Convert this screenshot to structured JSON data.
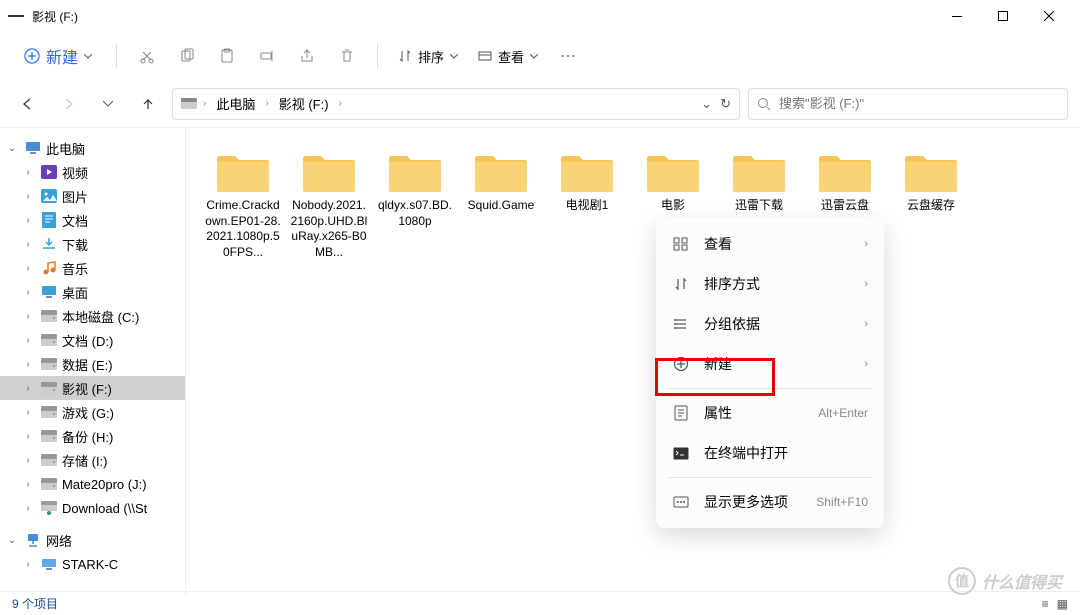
{
  "window": {
    "title": "影视 (F:)"
  },
  "toolbar": {
    "new_label": "新建",
    "sort_label": "排序",
    "view_label": "查看"
  },
  "breadcrumb": {
    "items": [
      "此电脑",
      "影视 (F:)"
    ]
  },
  "search": {
    "placeholder": "搜索\"影视 (F:)\""
  },
  "sidebar": {
    "root_pc": "此电脑",
    "items": [
      {
        "label": "视频",
        "icon": "video",
        "color": "#6a3eb8"
      },
      {
        "label": "图片",
        "icon": "pictures",
        "color": "#3aa0d8"
      },
      {
        "label": "文档",
        "icon": "documents",
        "color": "#3aa0d8"
      },
      {
        "label": "下载",
        "icon": "downloads",
        "color": "#3aa0d8"
      },
      {
        "label": "音乐",
        "icon": "music",
        "color": "#e07c2c"
      },
      {
        "label": "桌面",
        "icon": "desktop",
        "color": "#3aa0d8"
      },
      {
        "label": "本地磁盘 (C:)",
        "icon": "drive",
        "color": "#888"
      },
      {
        "label": "文档 (D:)",
        "icon": "drive",
        "color": "#888"
      },
      {
        "label": "数据 (E:)",
        "icon": "drive",
        "color": "#888"
      },
      {
        "label": "影视 (F:)",
        "icon": "drive",
        "color": "#888",
        "selected": true
      },
      {
        "label": "游戏 (G:)",
        "icon": "drive",
        "color": "#888"
      },
      {
        "label": "备份 (H:)",
        "icon": "drive",
        "color": "#888"
      },
      {
        "label": "存储 (I:)",
        "icon": "drive",
        "color": "#888"
      },
      {
        "label": "Mate20pro (J:)",
        "icon": "drive",
        "color": "#888"
      },
      {
        "label": "Download (\\\\St",
        "icon": "network-drive",
        "color": "#2a9d5c"
      }
    ],
    "network": "网络",
    "network_items": [
      {
        "label": "STARK-C"
      }
    ]
  },
  "folders": [
    {
      "name": "Crime.Crackdown.EP01-28.2021.1080p.50FPS..."
    },
    {
      "name": "Nobody.2021.2160p.UHD.BluRay.x265-B0MB..."
    },
    {
      "name": "qldyx.s07.BD.1080p"
    },
    {
      "name": "Squid.Game"
    },
    {
      "name": "电视剧1"
    },
    {
      "name": "电影"
    },
    {
      "name": "迅雷下载"
    },
    {
      "name": "迅雷云盘"
    },
    {
      "name": "云盘缓存"
    }
  ],
  "context_menu": {
    "items": [
      {
        "label": "查看",
        "icon": "view",
        "arrow": true
      },
      {
        "label": "排序方式",
        "icon": "sort",
        "arrow": true
      },
      {
        "label": "分组依据",
        "icon": "group",
        "arrow": true
      },
      {
        "label": "新建",
        "icon": "new",
        "arrow": true
      },
      {
        "label": "属性",
        "icon": "properties",
        "shortcut": "Alt+Enter",
        "highlighted": true
      },
      {
        "label": "在终端中打开",
        "icon": "terminal"
      },
      {
        "label": "显示更多选项",
        "icon": "more",
        "shortcut": "Shift+F10"
      }
    ]
  },
  "statusbar": {
    "count": "9 个项目"
  },
  "watermark": {
    "text": "什么值得买",
    "badge": "值"
  }
}
